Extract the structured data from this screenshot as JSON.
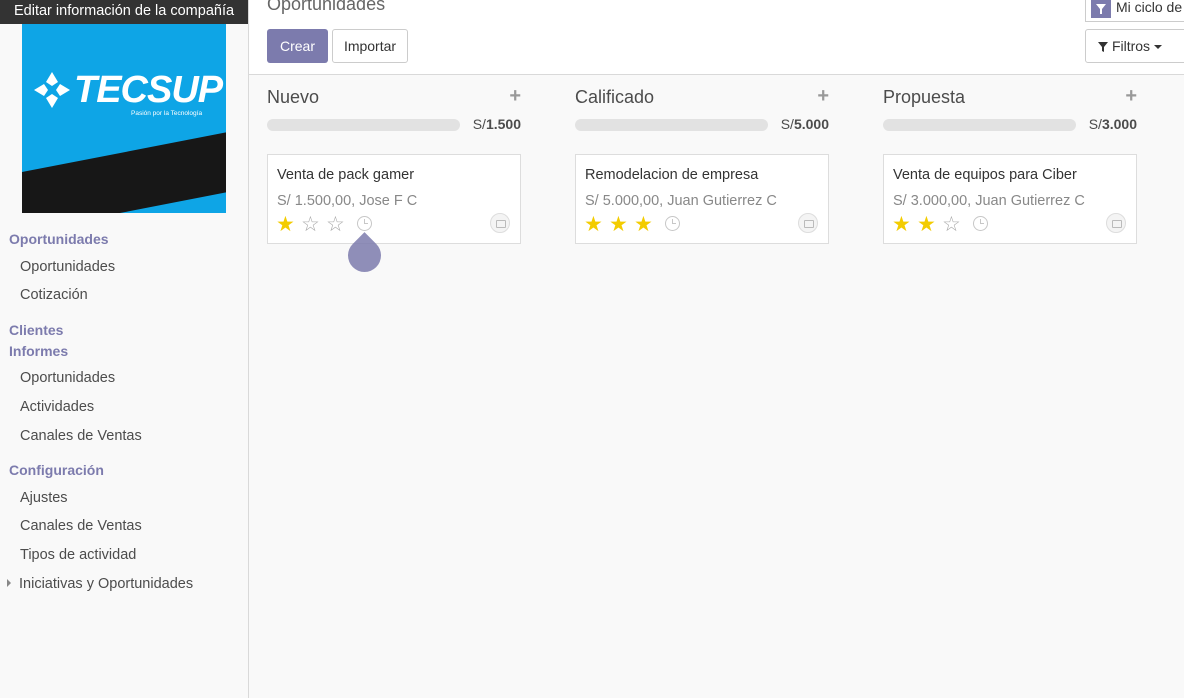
{
  "tooltip": "Editar información de la compañía",
  "logo": {
    "word": "TECSUP",
    "slogan": "Pasión por la Tecnología"
  },
  "sidebar": {
    "sections": [
      {
        "label": "Oportunidades",
        "items": [
          "Oportunidades",
          "Cotización"
        ]
      },
      {
        "label": "Clientes",
        "items": []
      },
      {
        "label": "Informes",
        "items": [
          "Oportunidades",
          "Actividades",
          "Canales de Ventas"
        ]
      },
      {
        "label": "Configuración",
        "items": [
          "Ajustes",
          "Canales de Ventas",
          "Tipos de actividad",
          "Iniciativas y Oportunidades"
        ]
      }
    ]
  },
  "header": {
    "title": "Oportunidades",
    "create_label": "Crear",
    "import_label": "Importar",
    "facet_label": "Mi ciclo de",
    "filters_label": "Filtros"
  },
  "columns": [
    {
      "title": "Nuevo",
      "total_prefix": "S/",
      "total": "1.500",
      "card": {
        "name": "Venta de pack gamer",
        "info": "S/ 1.500,00, Jose F C",
        "stars": 1
      }
    },
    {
      "title": "Calificado",
      "total_prefix": "S/",
      "total": "5.000",
      "card": {
        "name": "Remodelacion de empresa",
        "info": "S/ 5.000,00, Juan Gutierrez C",
        "stars": 3
      }
    },
    {
      "title": "Propuesta",
      "total_prefix": "S/",
      "total": "3.000",
      "card": {
        "name": "Venta de equipos para Ciber",
        "info": "S/ 3.000,00, Juan Gutierrez C",
        "stars": 2
      }
    }
  ],
  "colors": {
    "accent": "#7c7bad",
    "star": "#f3cc00",
    "logo_bg": "#0ea5e6"
  }
}
